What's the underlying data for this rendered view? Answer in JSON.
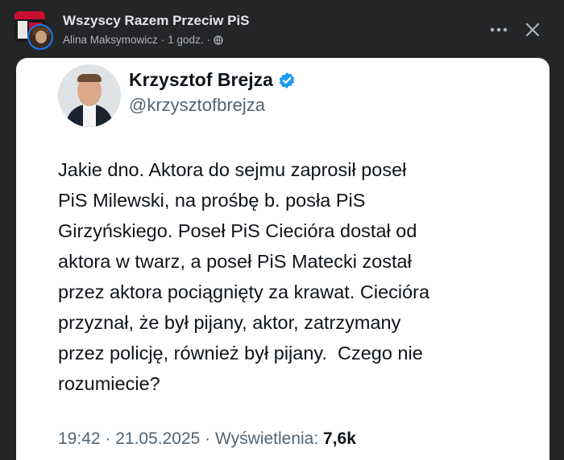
{
  "post": {
    "group_name": "Wszyscy Razem Przeciw PiS",
    "author": "Alina Maksymowicz",
    "separator": " · ",
    "time": "1 godz.",
    "dot": "·"
  },
  "tweet": {
    "name": "Krzysztof Brejza",
    "handle": "@krzysztofbrejza",
    "text": "Jakie dno. Aktora do sejmu zaprosił poseł\nPiS Milewski, na prośbę b. posła PiS\nGirzyńskiego. Poseł PiS Cieciórа dostał od\naktora w twarz, a poseł PiS Matecki został\nprzez aktora pociągnięty za krawat. Cieciórа\nprzyznał, że był pijany, aktor, zatrzymany\nprzez policję, również był pijany.  Czego nie\nrozumiecie?",
    "time": "19:42",
    "date": "21.05.2025",
    "views_label": "Wyświetlenia:",
    "views": "7,6k",
    "sep": " · "
  },
  "icons": {
    "more": "more-horizontal-icon",
    "close": "close-icon",
    "globe": "globe-icon",
    "verified": "verified-badge-icon"
  },
  "colors": {
    "background": "#242526",
    "card": "#ffffff",
    "verified": "#1d9bf0",
    "avatar_ring": "#1877f2"
  }
}
